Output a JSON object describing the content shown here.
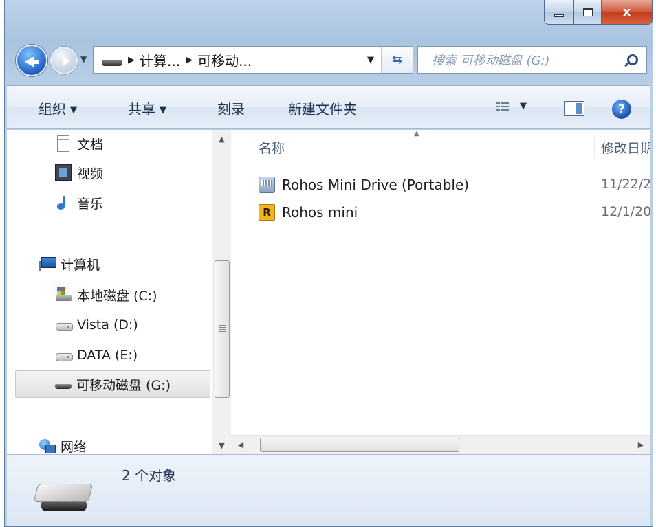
{
  "window": {
    "close_glyph": "x"
  },
  "nav": {
    "crumbs": [
      "计算...",
      "可移动..."
    ],
    "search_placeholder": "搜索 可移动磁盘 (G:)"
  },
  "toolbar": {
    "organize": "组织",
    "share": "共享",
    "burn": "刻录",
    "new_folder": "新建文件夹",
    "help_glyph": "?"
  },
  "nav_pane": {
    "items": [
      {
        "label": "文档",
        "icon": "documents-icon"
      },
      {
        "label": "视频",
        "icon": "videos-icon"
      },
      {
        "label": "音乐",
        "icon": "music-icon"
      },
      {
        "label": "计算机",
        "icon": "computer-icon"
      },
      {
        "label": "本地磁盘 (C:)",
        "icon": "local-disk-icon"
      },
      {
        "label": "Vista (D:)",
        "icon": "hard-drive-icon"
      },
      {
        "label": "DATA (E:)",
        "icon": "hard-drive-icon"
      },
      {
        "label": "可移动磁盘 (G:)",
        "icon": "removable-drive-icon",
        "selected": true
      },
      {
        "label": "网络",
        "icon": "network-icon"
      }
    ]
  },
  "file_list": {
    "columns": {
      "name": "名称",
      "date": "修改日期"
    },
    "rows": [
      {
        "name": "Rohos Mini Drive (Portable)",
        "date": "11/22/2",
        "icon": "application-icon"
      },
      {
        "name": "Rohos mini",
        "date": "12/1/20",
        "icon": "rohos-r-icon",
        "icon_letter": "R"
      }
    ]
  },
  "details": {
    "item_count": "2 个对象"
  },
  "colors": {
    "chrome_blue": "#a9c4e0",
    "close_red": "#c23a1d",
    "selection_gray": "#e2e2e2"
  }
}
